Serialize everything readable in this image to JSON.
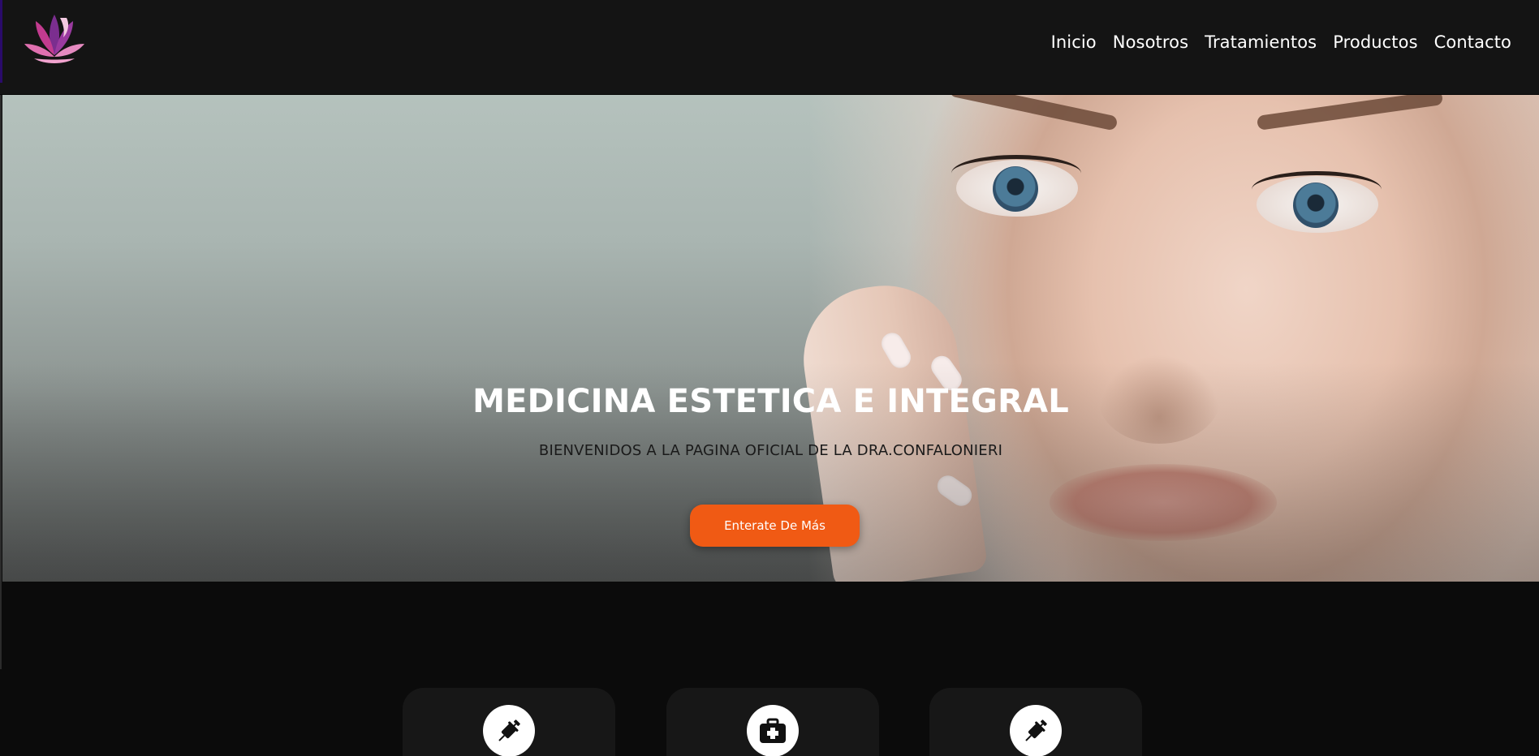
{
  "nav": {
    "items": [
      "Inicio",
      "Nosotros",
      "Tratamientos",
      "Productos",
      "Contacto"
    ]
  },
  "hero": {
    "title": "MEDICINA ESTETICA E INTEGRAL",
    "subtitle": "BIENVENIDOS A LA PAGINA OFICIAL DE LA DRA.CONFALONIERI",
    "cta_label": "Enterate De Más"
  },
  "features": {
    "icons": [
      "syringe-icon",
      "medical-kit-icon",
      "syringe-icon"
    ]
  },
  "colors": {
    "header_bg": "#141414",
    "page_bg": "#0b0b0b",
    "accent": "#f05a14",
    "card_bg": "#171717"
  }
}
